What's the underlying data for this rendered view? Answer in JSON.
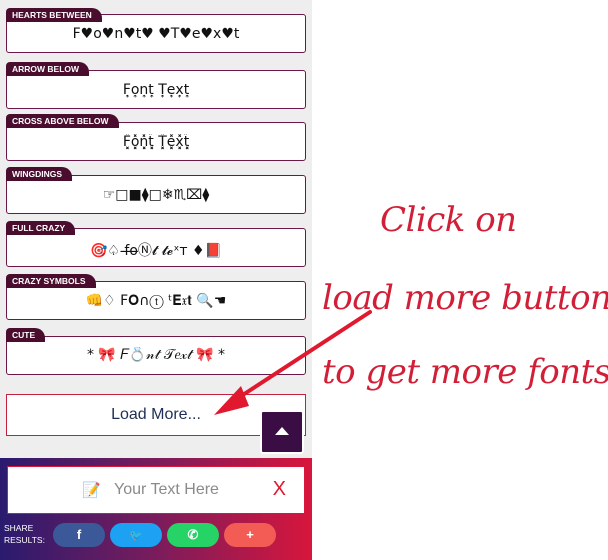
{
  "fonts": [
    {
      "tag": "HEARTS BETWEEN",
      "sample": "F♥o♥n♥t♥ ♥T♥e♥x♥t"
    },
    {
      "tag": "ARROW BELOW",
      "sample": "F͎o͎n͎t͎ T͎e͎x͎t͎"
    },
    {
      "tag": "CROSS ABOVE BELOW",
      "sample": "F͓̽o͓̽n͓̽t͓̽ T͓̽e͓̽x͓̽t͓̽"
    },
    {
      "tag": "WINGDINGS",
      "sample": "☞□■⧫□❄♏⌧⧫"
    },
    {
      "tag": "FULL CRAZY",
      "sample": "🎯♤ f̶o̶Ⓝ𝓽 𝓽𝓮ˣт ♦📕"
    },
    {
      "tag": "CRAZY SYMBOLS",
      "sample": "👊♢ F𝐎∩ⓣ ᵗ𝐄𝔵𝐭 🔍☚"
    },
    {
      "tag": "CUTE",
      "sample": "* 🎀 𝐹💍𝓃𝓉 𝒯𝑒𝓍𝓉 🎀 *"
    }
  ],
  "load_more_label": "Load More...",
  "input": {
    "placeholder": "Your Text Here",
    "clear_label": "X"
  },
  "share": {
    "label_line1": "SHARE",
    "label_line2": "RESULTS:",
    "buttons": [
      {
        "name": "facebook",
        "label": "f",
        "color": "#3b5998"
      },
      {
        "name": "twitter",
        "label": "🐦",
        "color": "#1da1f2"
      },
      {
        "name": "whatsapp",
        "label": "✆",
        "color": "#25d366"
      },
      {
        "name": "more",
        "label": "+",
        "color": "#f25c54"
      }
    ]
  },
  "callout": {
    "line1": "Click on",
    "line2": "load more button",
    "line3": "to get more fonts"
  }
}
